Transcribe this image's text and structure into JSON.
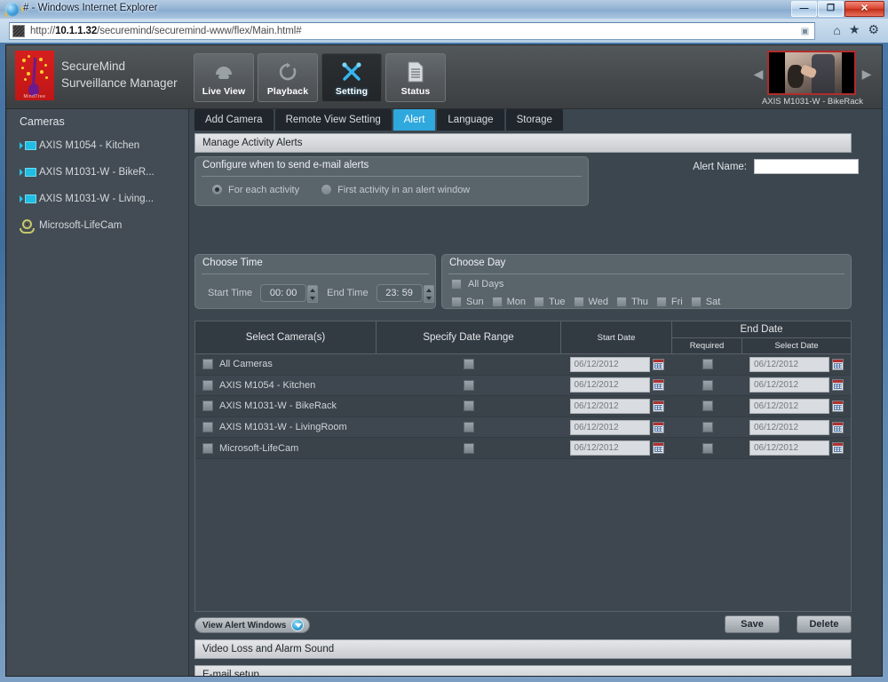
{
  "browser": {
    "title": "# - Windows Internet Explorer",
    "url_prefix": "http://",
    "url_host": "10.1.1.32",
    "url_rest": "/securemind/securemind-www/flex/Main.html#",
    "minimize_label": "—",
    "maximize_label": "❐",
    "close_label": "✕",
    "home_icon": "home-icon",
    "favorites_icon": "star-icon",
    "tools_icon": "gear-icon"
  },
  "app": {
    "brand_line1": "SecureMind",
    "brand_line2": "Surveillance Manager",
    "logo_caption": "MindTree",
    "nav": [
      {
        "label": "Live View",
        "icon": "dome-camera-icon",
        "active": false
      },
      {
        "label": "Playback",
        "icon": "refresh-arrow-icon",
        "active": false
      },
      {
        "label": "Setting",
        "icon": "tools-wrench-screwdriver-icon",
        "active": true
      },
      {
        "label": "Status",
        "icon": "document-lines-icon",
        "active": false
      }
    ],
    "preview": {
      "label": "AXIS M1031-W - BikeRack",
      "prev_arrow": "◀",
      "next_arrow": "▶"
    },
    "header_icons": {
      "help": "?",
      "export": "▤"
    }
  },
  "sidebar": {
    "title": "Cameras",
    "items": [
      {
        "label": "AXIS M1054 - Kitchen",
        "icon": "network-camera-icon"
      },
      {
        "label": "AXIS M1031-W - BikeR...",
        "icon": "network-camera-icon"
      },
      {
        "label": "AXIS M1031-W - Living...",
        "icon": "network-camera-icon"
      },
      {
        "label": "Microsoft-LifeCam",
        "icon": "webcam-icon"
      }
    ]
  },
  "tabs": [
    {
      "label": "Add Camera",
      "active": false
    },
    {
      "label": "Remote View Setting",
      "active": false
    },
    {
      "label": "Alert",
      "active": true
    },
    {
      "label": "Language",
      "active": false
    },
    {
      "label": "Storage",
      "active": false
    }
  ],
  "sections": {
    "manage_activity_alerts": "Manage Activity Alerts",
    "video_loss": "Video Loss and Alarm Sound",
    "email_setup": "E-mail setup"
  },
  "configure_panel": {
    "title": "Configure when to send e-mail alerts",
    "options": [
      {
        "label": "For each activity",
        "selected": true
      },
      {
        "label": "First activity in an alert window",
        "selected": false
      }
    ]
  },
  "alert_name": {
    "label": "Alert Name:",
    "value": "",
    "placeholder": ""
  },
  "choose_time": {
    "title": "Choose Time",
    "start_label": "Start Time",
    "start_value": "00: 00",
    "end_label": "End Time",
    "end_value": "23: 59"
  },
  "choose_day": {
    "title": "Choose Day",
    "all_days_label": "All Days",
    "all_days_checked": false,
    "days": [
      {
        "label": "Sun",
        "checked": false
      },
      {
        "label": "Mon",
        "checked": false
      },
      {
        "label": "Tue",
        "checked": false
      },
      {
        "label": "Wed",
        "checked": false
      },
      {
        "label": "Thu",
        "checked": false
      },
      {
        "label": "Fri",
        "checked": false
      },
      {
        "label": "Sat",
        "checked": false
      }
    ]
  },
  "table": {
    "headers": {
      "select_cameras": "Select Camera(s)",
      "specify_date_range": "Specify Date Range",
      "start_date": "Start Date",
      "end_date": "End Date",
      "required": "Required",
      "select_date": "Select Date"
    },
    "rows": [
      {
        "camera": "All Cameras",
        "range_checked": false,
        "start_date": "06/12/2012",
        "required_checked": false,
        "end_date": "06/12/2012"
      },
      {
        "camera": "AXIS M1054 - Kitchen",
        "range_checked": false,
        "start_date": "06/12/2012",
        "required_checked": false,
        "end_date": "06/12/2012"
      },
      {
        "camera": "AXIS M1031-W - BikeRack",
        "range_checked": false,
        "start_date": "06/12/2012",
        "required_checked": false,
        "end_date": "06/12/2012"
      },
      {
        "camera": "AXIS M1031-W - LivingRoom",
        "range_checked": false,
        "start_date": "06/12/2012",
        "required_checked": false,
        "end_date": "06/12/2012"
      },
      {
        "camera": "Microsoft-LifeCam",
        "range_checked": false,
        "start_date": "06/12/2012",
        "required_checked": false,
        "end_date": "06/12/2012"
      }
    ]
  },
  "footer": {
    "view_alert_windows": "View Alert Windows",
    "save": "Save",
    "delete": "Delete"
  },
  "colors": {
    "accent_blue": "#2fa8de",
    "app_bg": "#3c464e",
    "panel_bg": "#5a646b",
    "brand_red": "#d61f1f",
    "close_red": "#d9452f"
  }
}
